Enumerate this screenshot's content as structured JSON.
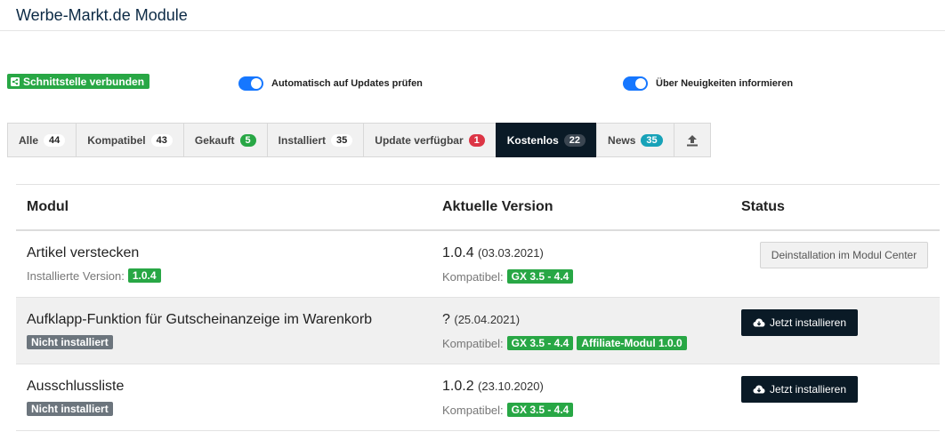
{
  "page": {
    "title": "Werbe-Markt.de Module"
  },
  "status": {
    "connection_label": "Schnittstelle verbunden"
  },
  "toggles": {
    "auto_update_label": "Automatisch auf Updates prüfen",
    "news_label": "Über Neuigkeiten informieren"
  },
  "tabs": [
    {
      "label": "Alle",
      "count": "44"
    },
    {
      "label": "Kompatibel",
      "count": "43"
    },
    {
      "label": "Gekauft",
      "count": "5"
    },
    {
      "label": "Installiert",
      "count": "35"
    },
    {
      "label": "Update verfügbar",
      "count": "1"
    },
    {
      "label": "Kostenlos",
      "count": "22"
    },
    {
      "label": "News",
      "count": "35"
    }
  ],
  "table": {
    "headers": {
      "module": "Modul",
      "version": "Aktuelle Version",
      "status": "Status"
    },
    "rows": [
      {
        "name": "Artikel verstecken",
        "installed_label": "Installierte Version:",
        "installed_version": "1.0.4",
        "version": "1.0.4",
        "date": "(03.03.2021)",
        "compat_label": "Kompatibel:",
        "compat": [
          "GX 3.5 - 4.4"
        ],
        "action": "Deinstallation im Modul Center"
      },
      {
        "name": "Aufklapp-Funktion für Gutscheinanzeige im Warenkorb",
        "state": "Nicht installiert",
        "version": "?",
        "date": "(25.04.2021)",
        "compat_label": "Kompatibel:",
        "compat": [
          "GX 3.5 - 4.4",
          "Affiliate-Modul 1.0.0"
        ],
        "action": "Jetzt installieren"
      },
      {
        "name": "Ausschlussliste",
        "state": "Nicht installiert",
        "version": "1.0.2",
        "date": "(23.10.2020)",
        "compat_label": "Kompatibel:",
        "compat": [
          "GX 3.5 - 4.4"
        ],
        "action": "Jetzt installieren"
      }
    ]
  },
  "colors": {
    "accent_dark": "#0a1a26",
    "success": "#28a745",
    "danger": "#dc3545",
    "toggle": "#1677ff",
    "info": "#17a2b8"
  },
  "icons": {
    "connection": "share-icon",
    "install": "cloud-download-icon",
    "upload": "upload-icon"
  }
}
